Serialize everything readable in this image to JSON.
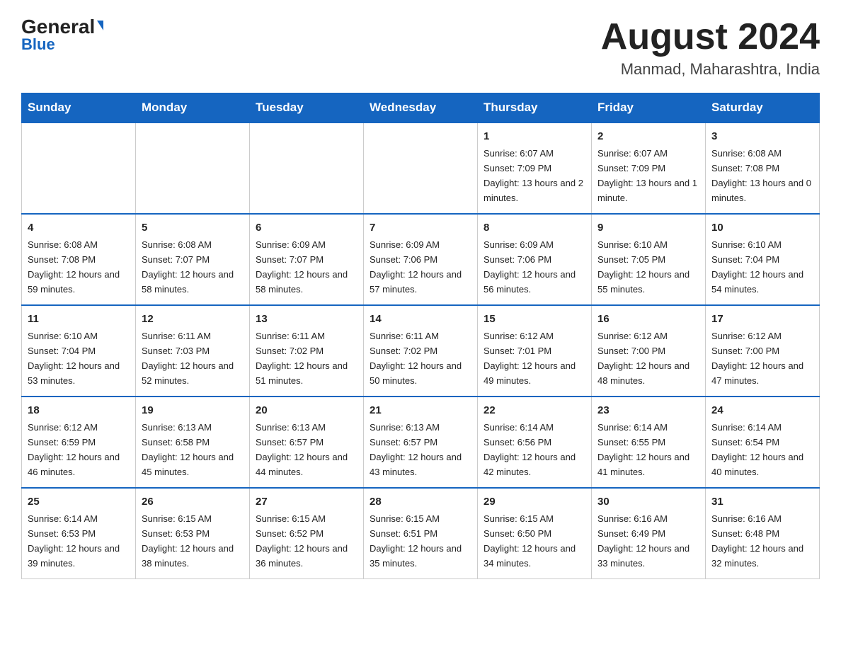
{
  "logo": {
    "general": "General",
    "blue": "Blue",
    "triangle": "▲"
  },
  "title": "August 2024",
  "subtitle": "Manmad, Maharashtra, India",
  "weekdays": [
    "Sunday",
    "Monday",
    "Tuesday",
    "Wednesday",
    "Thursday",
    "Friday",
    "Saturday"
  ],
  "weeks": [
    [
      {
        "day": "",
        "info": ""
      },
      {
        "day": "",
        "info": ""
      },
      {
        "day": "",
        "info": ""
      },
      {
        "day": "",
        "info": ""
      },
      {
        "day": "1",
        "info": "Sunrise: 6:07 AM\nSunset: 7:09 PM\nDaylight: 13 hours and 2 minutes."
      },
      {
        "day": "2",
        "info": "Sunrise: 6:07 AM\nSunset: 7:09 PM\nDaylight: 13 hours and 1 minute."
      },
      {
        "day": "3",
        "info": "Sunrise: 6:08 AM\nSunset: 7:08 PM\nDaylight: 13 hours and 0 minutes."
      }
    ],
    [
      {
        "day": "4",
        "info": "Sunrise: 6:08 AM\nSunset: 7:08 PM\nDaylight: 12 hours and 59 minutes."
      },
      {
        "day": "5",
        "info": "Sunrise: 6:08 AM\nSunset: 7:07 PM\nDaylight: 12 hours and 58 minutes."
      },
      {
        "day": "6",
        "info": "Sunrise: 6:09 AM\nSunset: 7:07 PM\nDaylight: 12 hours and 58 minutes."
      },
      {
        "day": "7",
        "info": "Sunrise: 6:09 AM\nSunset: 7:06 PM\nDaylight: 12 hours and 57 minutes."
      },
      {
        "day": "8",
        "info": "Sunrise: 6:09 AM\nSunset: 7:06 PM\nDaylight: 12 hours and 56 minutes."
      },
      {
        "day": "9",
        "info": "Sunrise: 6:10 AM\nSunset: 7:05 PM\nDaylight: 12 hours and 55 minutes."
      },
      {
        "day": "10",
        "info": "Sunrise: 6:10 AM\nSunset: 7:04 PM\nDaylight: 12 hours and 54 minutes."
      }
    ],
    [
      {
        "day": "11",
        "info": "Sunrise: 6:10 AM\nSunset: 7:04 PM\nDaylight: 12 hours and 53 minutes."
      },
      {
        "day": "12",
        "info": "Sunrise: 6:11 AM\nSunset: 7:03 PM\nDaylight: 12 hours and 52 minutes."
      },
      {
        "day": "13",
        "info": "Sunrise: 6:11 AM\nSunset: 7:02 PM\nDaylight: 12 hours and 51 minutes."
      },
      {
        "day": "14",
        "info": "Sunrise: 6:11 AM\nSunset: 7:02 PM\nDaylight: 12 hours and 50 minutes."
      },
      {
        "day": "15",
        "info": "Sunrise: 6:12 AM\nSunset: 7:01 PM\nDaylight: 12 hours and 49 minutes."
      },
      {
        "day": "16",
        "info": "Sunrise: 6:12 AM\nSunset: 7:00 PM\nDaylight: 12 hours and 48 minutes."
      },
      {
        "day": "17",
        "info": "Sunrise: 6:12 AM\nSunset: 7:00 PM\nDaylight: 12 hours and 47 minutes."
      }
    ],
    [
      {
        "day": "18",
        "info": "Sunrise: 6:12 AM\nSunset: 6:59 PM\nDaylight: 12 hours and 46 minutes."
      },
      {
        "day": "19",
        "info": "Sunrise: 6:13 AM\nSunset: 6:58 PM\nDaylight: 12 hours and 45 minutes."
      },
      {
        "day": "20",
        "info": "Sunrise: 6:13 AM\nSunset: 6:57 PM\nDaylight: 12 hours and 44 minutes."
      },
      {
        "day": "21",
        "info": "Sunrise: 6:13 AM\nSunset: 6:57 PM\nDaylight: 12 hours and 43 minutes."
      },
      {
        "day": "22",
        "info": "Sunrise: 6:14 AM\nSunset: 6:56 PM\nDaylight: 12 hours and 42 minutes."
      },
      {
        "day": "23",
        "info": "Sunrise: 6:14 AM\nSunset: 6:55 PM\nDaylight: 12 hours and 41 minutes."
      },
      {
        "day": "24",
        "info": "Sunrise: 6:14 AM\nSunset: 6:54 PM\nDaylight: 12 hours and 40 minutes."
      }
    ],
    [
      {
        "day": "25",
        "info": "Sunrise: 6:14 AM\nSunset: 6:53 PM\nDaylight: 12 hours and 39 minutes."
      },
      {
        "day": "26",
        "info": "Sunrise: 6:15 AM\nSunset: 6:53 PM\nDaylight: 12 hours and 38 minutes."
      },
      {
        "day": "27",
        "info": "Sunrise: 6:15 AM\nSunset: 6:52 PM\nDaylight: 12 hours and 36 minutes."
      },
      {
        "day": "28",
        "info": "Sunrise: 6:15 AM\nSunset: 6:51 PM\nDaylight: 12 hours and 35 minutes."
      },
      {
        "day": "29",
        "info": "Sunrise: 6:15 AM\nSunset: 6:50 PM\nDaylight: 12 hours and 34 minutes."
      },
      {
        "day": "30",
        "info": "Sunrise: 6:16 AM\nSunset: 6:49 PM\nDaylight: 12 hours and 33 minutes."
      },
      {
        "day": "31",
        "info": "Sunrise: 6:16 AM\nSunset: 6:48 PM\nDaylight: 12 hours and 32 minutes."
      }
    ]
  ]
}
